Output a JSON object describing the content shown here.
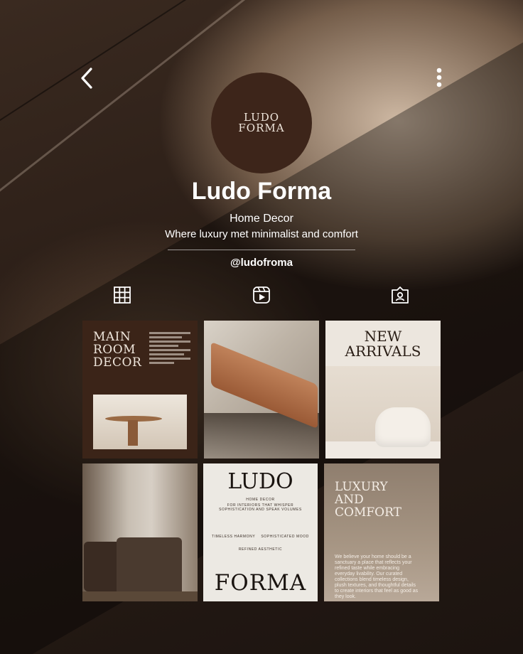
{
  "profile": {
    "avatar_line1": "LUDO",
    "avatar_line2": "FORMA",
    "name": "Ludo Forma",
    "category": "Home Decor",
    "bio": "Where luxury met minimalist and comfort",
    "handle": "@ludofroma"
  },
  "icons": {
    "back": "chevron-left-icon",
    "more": "more-vertical-icon",
    "tabs": [
      "grid-icon",
      "reels-icon",
      "tagged-icon"
    ]
  },
  "posts": {
    "p1": {
      "title_l1": "MAIN",
      "title_l2": "ROOM",
      "title_l3": "DECOR"
    },
    "p3": {
      "title_l1": "NEW",
      "title_l2": "ARRIVALS"
    },
    "p5": {
      "top": "LUDO",
      "sub1": "HOME DECOR",
      "sub2": "FOR INTERIORS THAT WHISPER",
      "sub3": "SOPHISTICATION AND SPEAK VOLUMES",
      "left": "TIMELESS HARMONY",
      "right": "SOPHISTICATED MOOD",
      "mid": "REFINED AESTHETIC",
      "bottom": "FORMA"
    },
    "p6": {
      "title_l1": "LUXURY",
      "title_l2": "AND",
      "title_l3": "COMFORT",
      "body": "We believe your home should be a sanctuary a place that reflects your refined taste while embracing everyday livability. Our curated collections blend timeless design, plush textures, and thoughtful details to create interiors that feel as good as they look."
    }
  },
  "colors": {
    "avatar_bg": "#3d251a",
    "tile_dark": "#3b2418",
    "text_white": "#ffffff"
  }
}
